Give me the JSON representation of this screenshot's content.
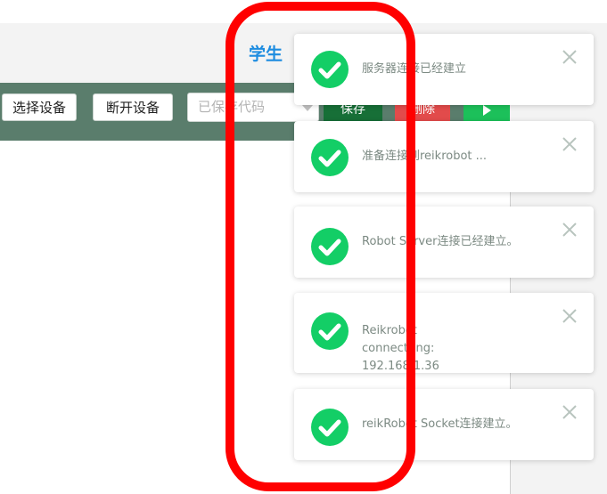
{
  "header": {
    "title": "学生"
  },
  "toolbar": {
    "select_device_label": "选择设备",
    "disconnect_device_label": "断开设备",
    "code_select_placeholder": "已保存代码",
    "save_label": "保存",
    "delete_label": "删除",
    "run_icon": "play-icon"
  },
  "notifications": [
    {
      "message": "服务器连接已经建立",
      "icon": "check-circle-icon"
    },
    {
      "message": "准备连接到reikrobot ...",
      "icon": "check-circle-icon"
    },
    {
      "message": "Robot Server连接已经建立。",
      "icon": "check-circle-icon"
    },
    {
      "message": "Reikrobot connectting: 192.168.1.36",
      "icon": "check-circle-icon"
    },
    {
      "message": "reikRobot Socket连接建立。",
      "icon": "check-circle-icon"
    }
  ],
  "colors": {
    "brand_blue": "#1d8ce0",
    "toolbar_green": "#5a7d6c",
    "success_green": "#13ce66",
    "save_green": "#176f37",
    "delete_red": "#e24b4b",
    "annotation_red": "#ff0000"
  }
}
